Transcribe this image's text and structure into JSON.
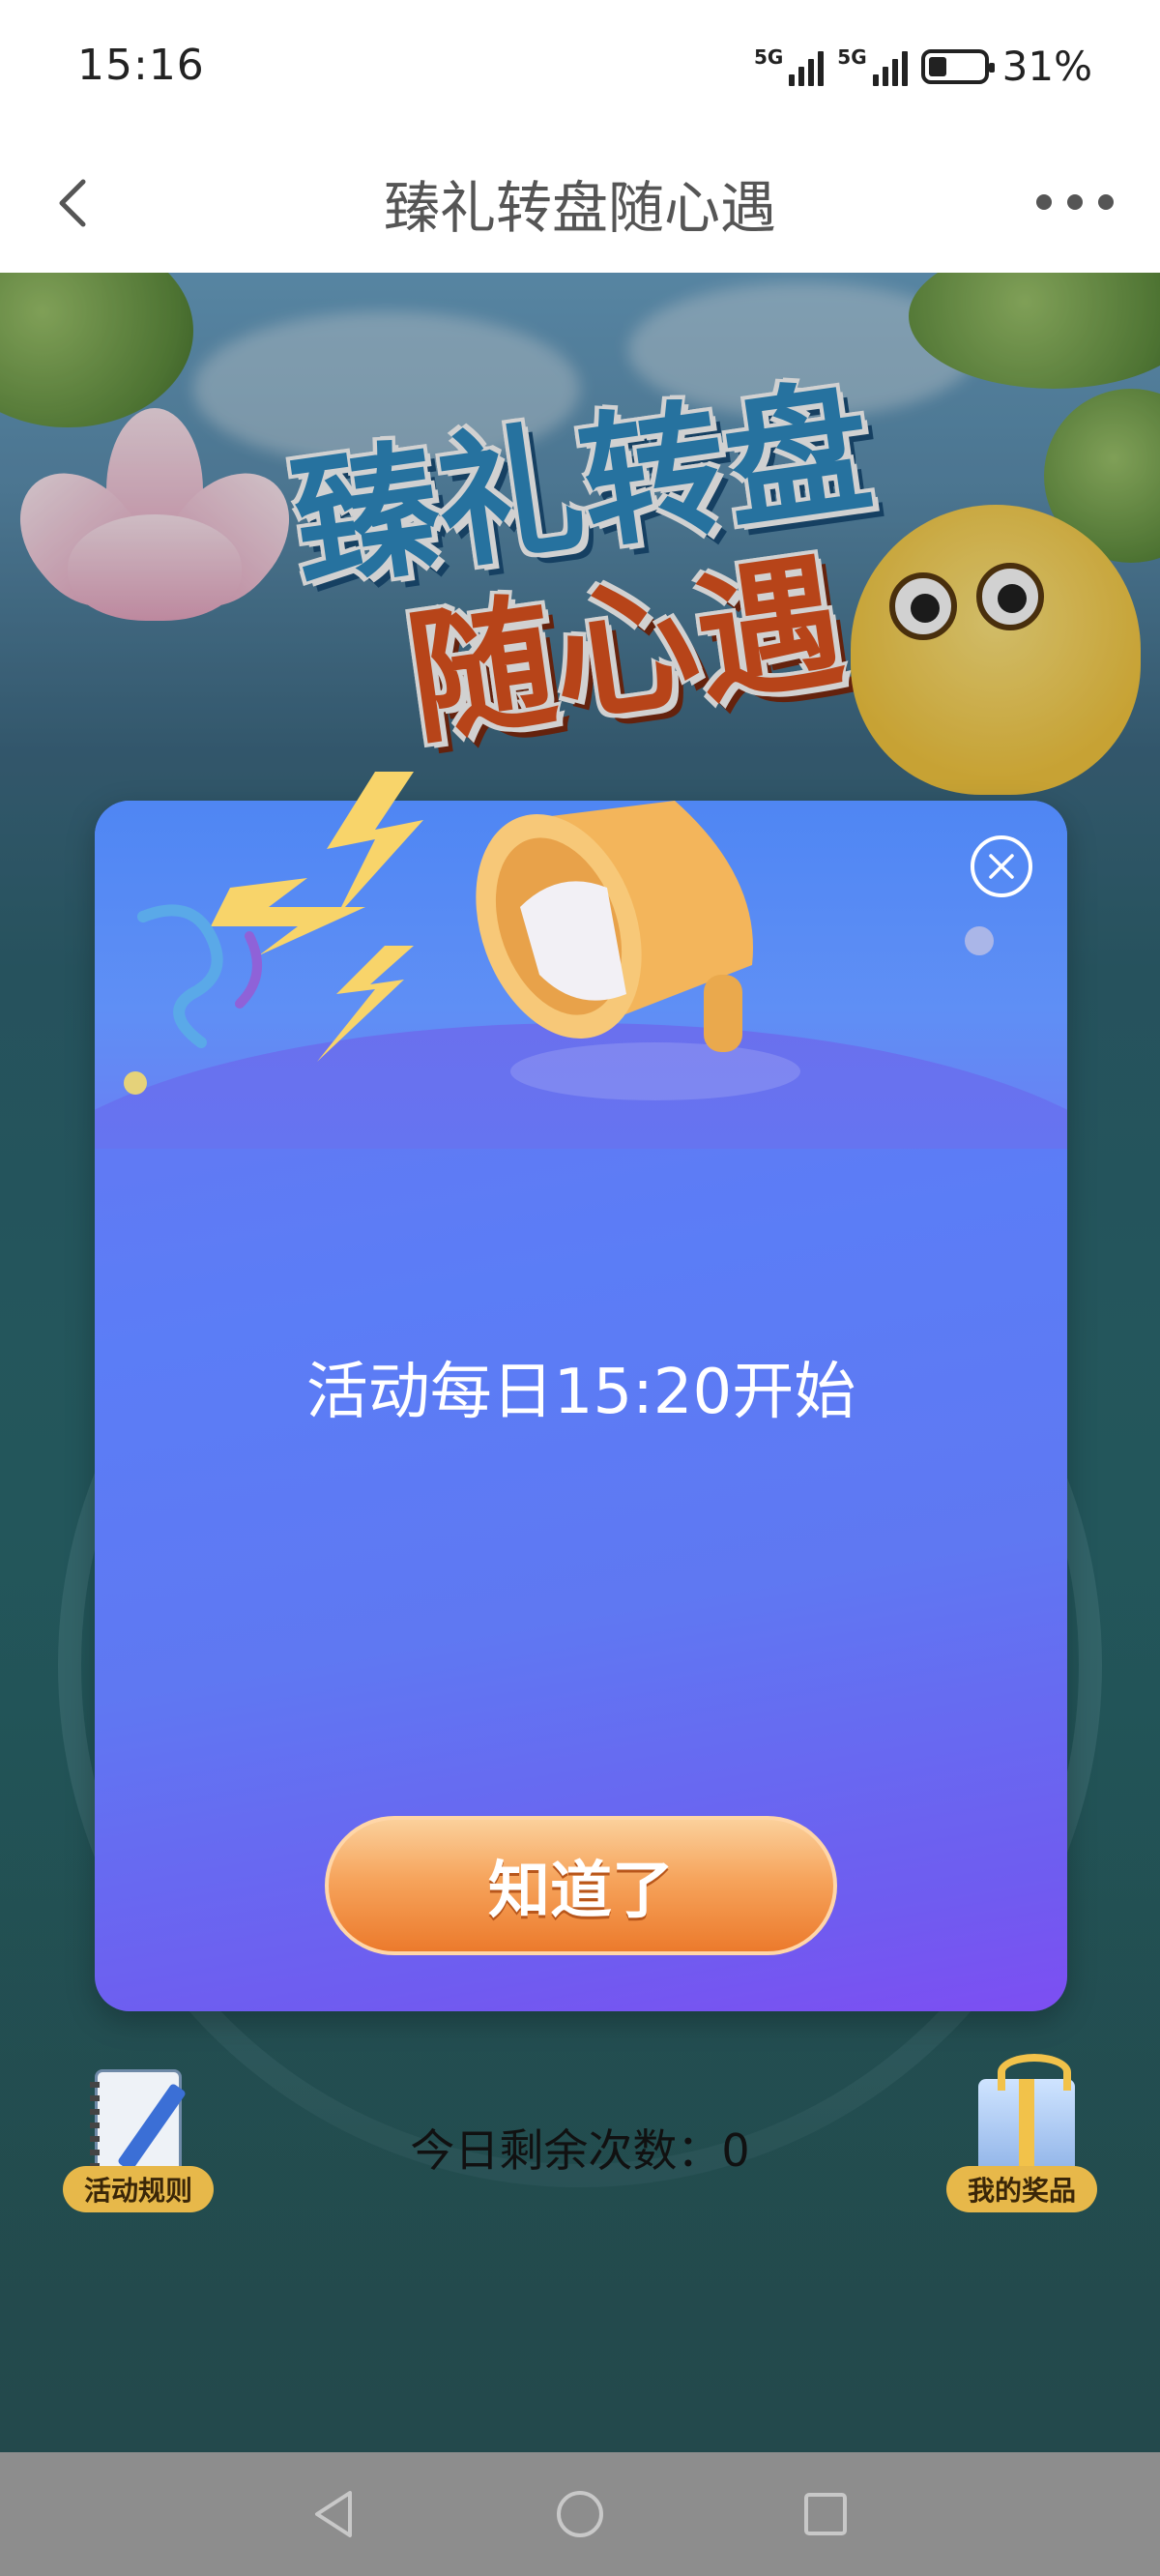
{
  "status_bar": {
    "time": "15:16",
    "signal_1_tag": "5G",
    "signal_2_tag": "5G",
    "battery": "31%"
  },
  "nav": {
    "title": "臻礼转盘随心遇"
  },
  "banner": {
    "line1": "臻礼转盘",
    "line2": "随心遇"
  },
  "modal": {
    "message": "活动每日15:20开始",
    "confirm_label": "知道了"
  },
  "actions": {
    "rules_label": "活动规则",
    "prizes_label": "我的奖品"
  },
  "remaining": {
    "text": "今日剩余次数：0"
  },
  "colors": {
    "modal_primary": "#5b7df6",
    "button_orange": "#f6a45c",
    "badge_gold": "#e7b84a"
  }
}
